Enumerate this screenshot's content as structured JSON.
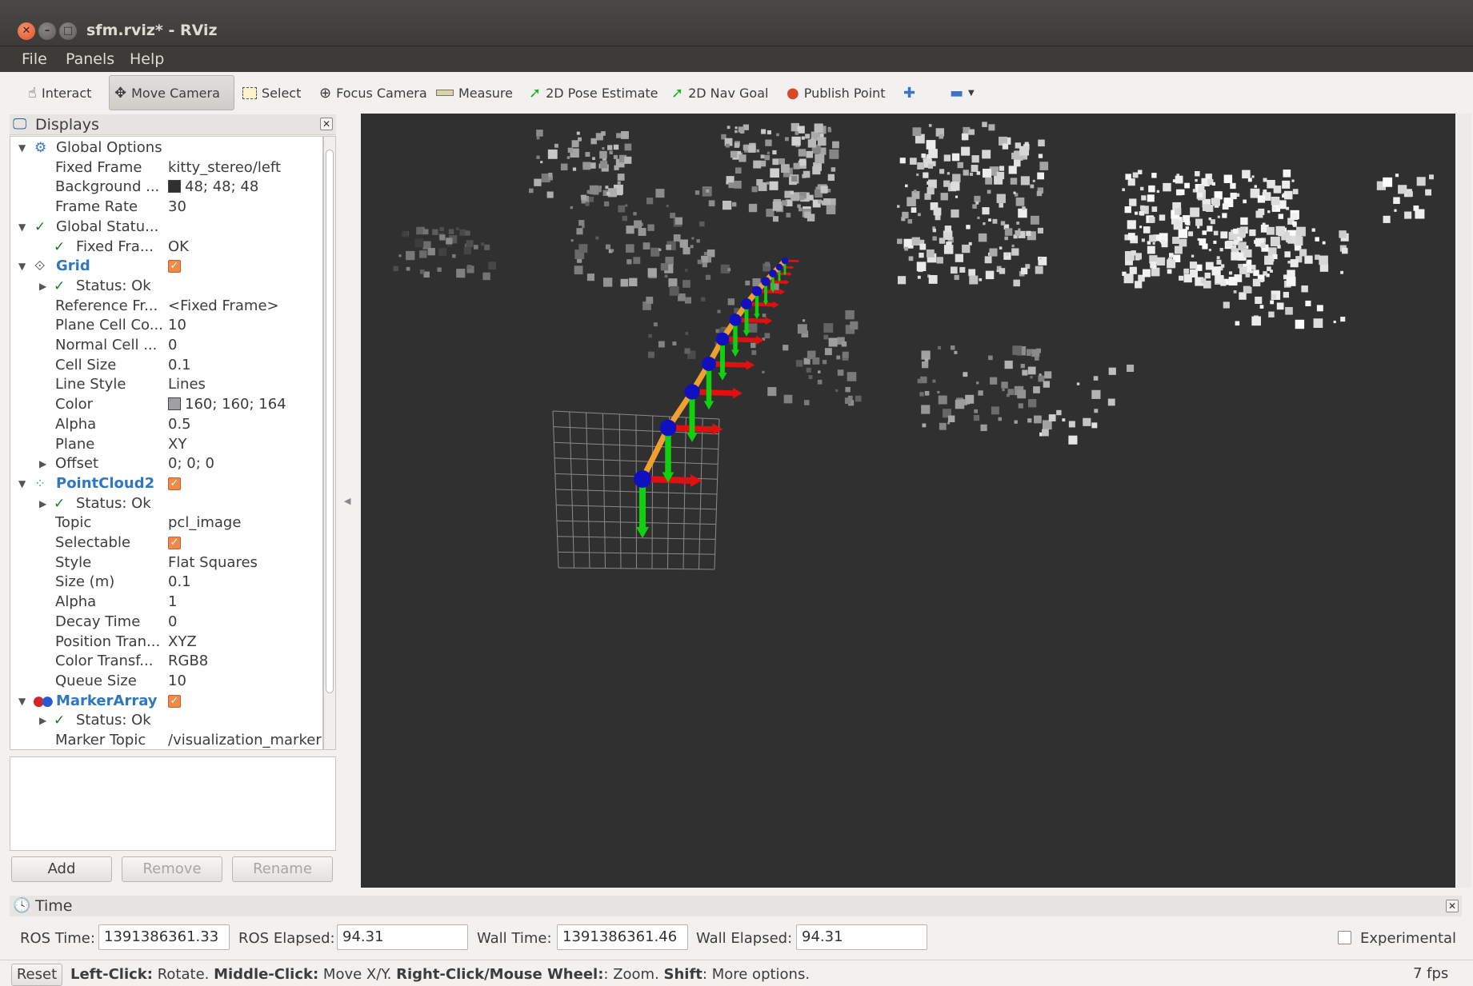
{
  "window": {
    "title": "sfm.rviz* - RViz"
  },
  "menu": [
    "File",
    "Panels",
    "Help"
  ],
  "toolbar": {
    "interact": "Interact",
    "move_camera": "Move Camera",
    "select": "Select",
    "focus_camera": "Focus Camera",
    "measure": "Measure",
    "pose_estimate": "2D Pose Estimate",
    "nav_goal": "2D Nav Goal",
    "publish_point": "Publish Point"
  },
  "displays": {
    "title": "Displays",
    "rows": [
      {
        "label": "Global Options",
        "value": ""
      },
      {
        "label": "Fixed Frame",
        "value": "kitty_stereo/left"
      },
      {
        "label": "Background ...",
        "value": "48; 48; 48"
      },
      {
        "label": "Frame Rate",
        "value": "30"
      },
      {
        "label": "Global Statu...",
        "value": ""
      },
      {
        "label": "Fixed Fra...",
        "value": "OK"
      },
      {
        "label": "Grid",
        "value": ""
      },
      {
        "label": "Status: Ok",
        "value": ""
      },
      {
        "label": "Reference Fr...",
        "value": "<Fixed Frame>"
      },
      {
        "label": "Plane Cell Co...",
        "value": "10"
      },
      {
        "label": "Normal Cell ...",
        "value": "0"
      },
      {
        "label": "Cell Size",
        "value": "0.1"
      },
      {
        "label": "Line Style",
        "value": "Lines"
      },
      {
        "label": "Color",
        "value": "160; 160; 164"
      },
      {
        "label": "Alpha",
        "value": "0.5"
      },
      {
        "label": "Plane",
        "value": "XY"
      },
      {
        "label": "Offset",
        "value": "0; 0; 0"
      },
      {
        "label": "PointCloud2",
        "value": ""
      },
      {
        "label": "Status: Ok",
        "value": ""
      },
      {
        "label": "Topic",
        "value": "pcl_image"
      },
      {
        "label": "Selectable",
        "value": ""
      },
      {
        "label": "Style",
        "value": "Flat Squares"
      },
      {
        "label": "Size (m)",
        "value": "0.1"
      },
      {
        "label": "Alpha",
        "value": "1"
      },
      {
        "label": "Decay Time",
        "value": "0"
      },
      {
        "label": "Position Tran...",
        "value": "XYZ"
      },
      {
        "label": "Color Transf...",
        "value": "RGB8"
      },
      {
        "label": "Queue Size",
        "value": "10"
      },
      {
        "label": "MarkerArray",
        "value": ""
      },
      {
        "label": "Status: Ok",
        "value": ""
      },
      {
        "label": "Marker Topic",
        "value": "/visualization_marker"
      }
    ],
    "buttons": {
      "add": "Add",
      "remove": "Remove",
      "rename": "Rename"
    }
  },
  "time": {
    "title": "Time",
    "ros_time_label": "ROS Time:",
    "ros_time": "1391386361.33",
    "ros_elapsed_label": "ROS Elapsed:",
    "ros_elapsed": "94.31",
    "wall_time_label": "Wall Time:",
    "wall_time": "1391386361.46",
    "wall_elapsed_label": "Wall Elapsed:",
    "wall_elapsed": "94.31",
    "experimental": "Experimental"
  },
  "status": {
    "reset": "Reset",
    "k1": "Left-Click:",
    "v1": " Rotate. ",
    "k2": "Middle-Click:",
    "v2": " Move X/Y. ",
    "k3": "Right-Click/Mouse Wheel:",
    "v3": ": Zoom. ",
    "k4": "Shift",
    "v4": ": More options.",
    "fps": "7 fps"
  },
  "colors": {
    "background": "#303030",
    "path": "#f0a030",
    "x_axis": "#e01010",
    "y_axis": "#10d010",
    "z_axis": "#1010c0"
  }
}
